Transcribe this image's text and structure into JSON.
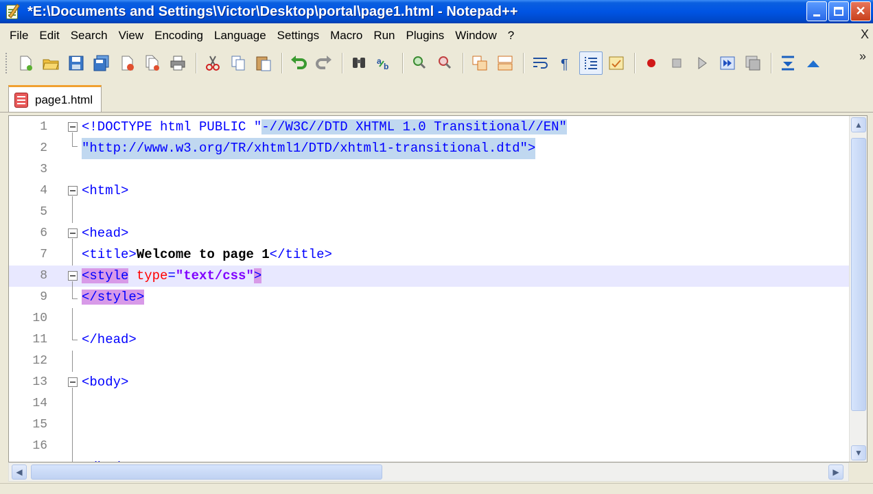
{
  "window": {
    "title": "*E:\\Documents and Settings\\Victor\\Desktop\\portal\\page1.html - Notepad++"
  },
  "menu": {
    "items": [
      "File",
      "Edit",
      "Search",
      "View",
      "Encoding",
      "Language",
      "Settings",
      "Macro",
      "Run",
      "Plugins",
      "Window",
      "?"
    ],
    "close_label": "X"
  },
  "toolbar": {
    "overflow_label": "»"
  },
  "tabs": [
    {
      "label": "page1.html",
      "active": true
    }
  ],
  "editor": {
    "line_numbers": [
      "1",
      "2",
      "3",
      "4",
      "5",
      "6",
      "7",
      "8",
      "9",
      "10",
      "11",
      "12",
      "13",
      "14",
      "15",
      "16"
    ],
    "lines": {
      "l1_lt": "<",
      "l1_doctype": "!DOCTYPE html PUBLIC ",
      "l1_q": "\"",
      "l1_sel": "-//W3C//DTD XHTML 1.0 Transitional//EN",
      "l1_qend": "\"",
      "l2_sel": "\"http://www.w3.org/TR/xhtml1/DTD/xhtml1-transitional.dtd\">",
      "l4": "<html>",
      "l6": "<head>",
      "l7_open": "<title>",
      "l7_text": "Welcome to page 1",
      "l7_close": "</title>",
      "l8_open": "<style",
      "l8_sp": " ",
      "l8_attr": "type",
      "l8_eq": "=",
      "l8_val": "\"text/css\"",
      "l8_end": ">",
      "l9": "</style>",
      "l11": "</head>",
      "l13": "<body>",
      "l17_partial": "</body>"
    }
  },
  "colors": {
    "tag": "#0000ff",
    "attribute": "#ff0000",
    "value": "#8000ff",
    "selection": "#c0d8f0",
    "brace_match": "#d89ae8",
    "current_line": "#e8e8ff"
  }
}
